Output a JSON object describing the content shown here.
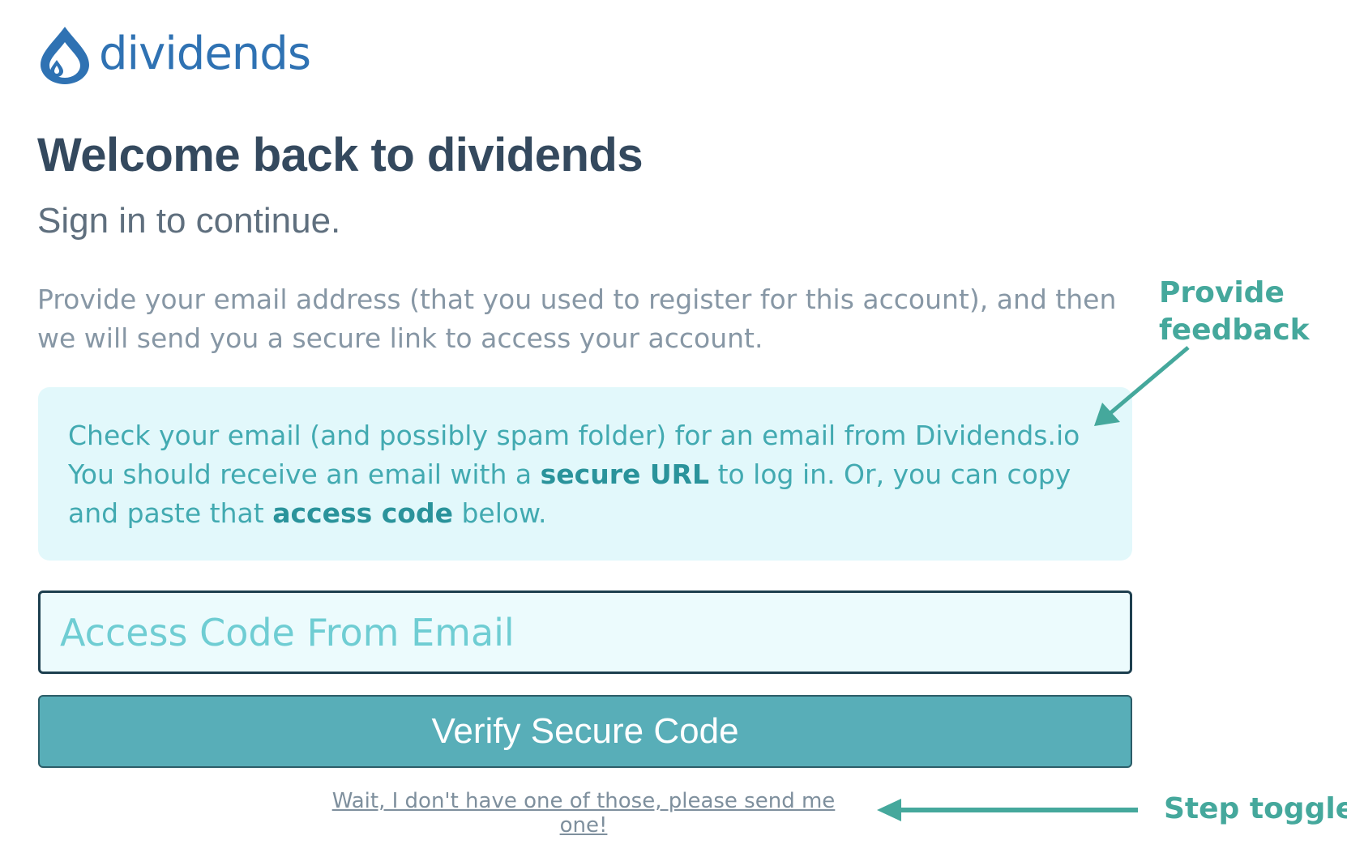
{
  "brand": {
    "name": "dividends",
    "logo_icon": "water-drop-icon",
    "color": "#2f72b3"
  },
  "heading": {
    "title": "Welcome back to dividends",
    "subtitle": "Sign in to continue."
  },
  "intro": {
    "text": "Provide your email address (that you used to register for this account), and then we will send you a secure link to access your account."
  },
  "notice": {
    "line1": "Check your email (and possibly spam folder) for an email from Dividends.io",
    "line2_before": "You should receive an email with a ",
    "line2_bold": "secure URL",
    "line2_after": " to log in. Or, you can copy",
    "line3_before": "and paste that ",
    "line3_bold": "access code",
    "line3_after": " below.",
    "background": "#e2f8fb",
    "text_color": "#42aab1"
  },
  "form": {
    "code_placeholder": "Access Code From Email",
    "code_value": "",
    "verify_label": "Verify Secure Code",
    "button_color": "#58aeb8",
    "toggle_link": "Wait, I don't have one of those, please send me one!"
  },
  "annotations": {
    "feedback_line1": "Provide",
    "feedback_line2": "feedback",
    "step_toggle": "Step toggle",
    "color": "#45a89c"
  }
}
